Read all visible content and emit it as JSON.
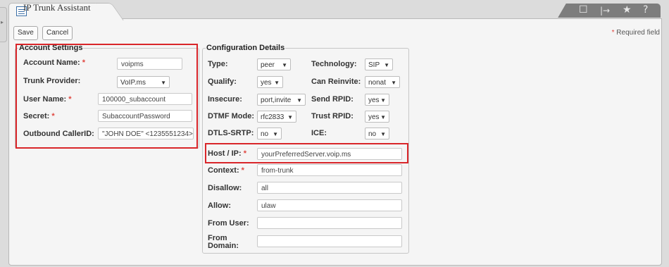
{
  "tab": {
    "title": "IP Trunk Assistant",
    "icon": "list-icon"
  },
  "toolbar": {
    "icons": [
      "edit-icon",
      "pin-icon",
      "star-icon",
      "help-icon"
    ],
    "icon_glyphs": [
      "☐",
      "|→",
      "★",
      "?"
    ],
    "save_label": "Save",
    "cancel_label": "Cancel",
    "required_star": "*",
    "required_text": "Required field"
  },
  "account": {
    "legend": "Account Settings",
    "name_label": "Account Name:",
    "name_value": "voipms",
    "provider_label": "Trunk Provider:",
    "provider_value": "VoIP.ms",
    "user_label": "User Name:",
    "user_value": "100000_subaccount",
    "secret_label": "Secret:",
    "secret_value": "SubaccountPassword",
    "callerid_label": "Outbound CallerID:",
    "callerid_value": "\"JOHN DOE\" <1235551234>"
  },
  "config": {
    "legend": "Configuration Details",
    "type_label": "Type:",
    "type_value": "peer",
    "technology_label": "Technology:",
    "technology_value": "SIP",
    "qualify_label": "Qualify:",
    "qualify_value": "yes",
    "canreinvite_label": "Can Reinvite:",
    "canreinvite_value": "nonat",
    "insecure_label": "Insecure:",
    "insecure_value": "port,invite",
    "sendrpid_label": "Send RPID:",
    "sendrpid_value": "yes",
    "dtmf_label": "DTMF Mode:",
    "dtmf_value": "rfc2833",
    "trustrpid_label": "Trust RPID:",
    "trustrpid_value": "yes",
    "dtls_label": "DTLS-SRTP:",
    "dtls_value": "no",
    "ice_label": "ICE:",
    "ice_value": "no",
    "host_label": "Host / IP:",
    "host_value": "yourPreferredServer.voip.ms",
    "context_label": "Context:",
    "context_value": "from-trunk",
    "disallow_label": "Disallow:",
    "disallow_value": "all",
    "allow_label": "Allow:",
    "allow_value": "ulaw",
    "fromuser_label": "From User:",
    "fromuser_value": "",
    "fromdomain_label_1": "From",
    "fromdomain_label_2": "Domain:",
    "fromdomain_value": ""
  },
  "colors": {
    "highlight": "#d9262a",
    "required": "#e0463f"
  }
}
